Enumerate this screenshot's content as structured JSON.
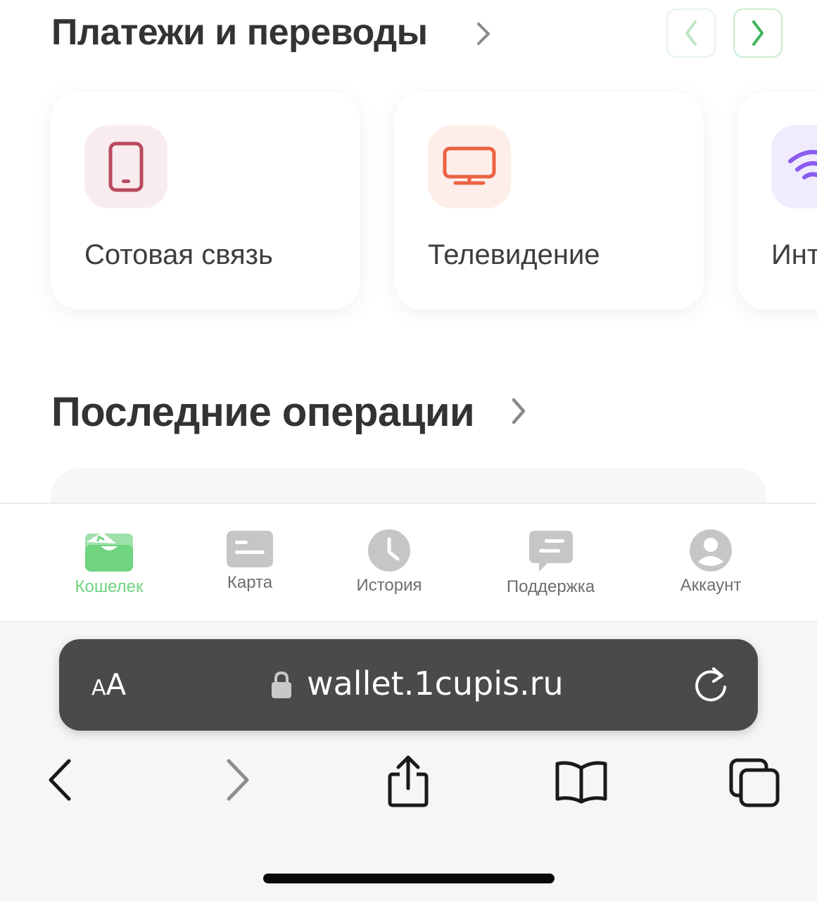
{
  "payments": {
    "title": "Платежи и переводы",
    "cards": [
      {
        "label": "Сотовая связь",
        "icon": "smartphone-icon",
        "color": "#b94a5e",
        "bg": "#f9ecef"
      },
      {
        "label": "Телевидение",
        "icon": "tv-icon",
        "color": "#ec6242",
        "bg": "#fdeee9"
      },
      {
        "label": "Инт",
        "icon": "wifi-icon",
        "color": "#8a5cf0",
        "bg": "#f1ecfd"
      }
    ]
  },
  "operations": {
    "title": "Последние операции"
  },
  "app_nav": {
    "tabs": [
      {
        "label": "Кошелек",
        "icon": "wallet-icon",
        "active": true
      },
      {
        "label": "Карта",
        "icon": "card-icon"
      },
      {
        "label": "История",
        "icon": "clock-icon"
      },
      {
        "label": "Поддержка",
        "icon": "chat-icon"
      },
      {
        "label": "Аккаунт",
        "icon": "user-icon"
      }
    ]
  },
  "browser": {
    "aa_small": "A",
    "aa_big": "A",
    "url": "wallet.1cupis.ru"
  },
  "colors": {
    "accent_green": "#6fd37f",
    "heading": "#333333"
  }
}
